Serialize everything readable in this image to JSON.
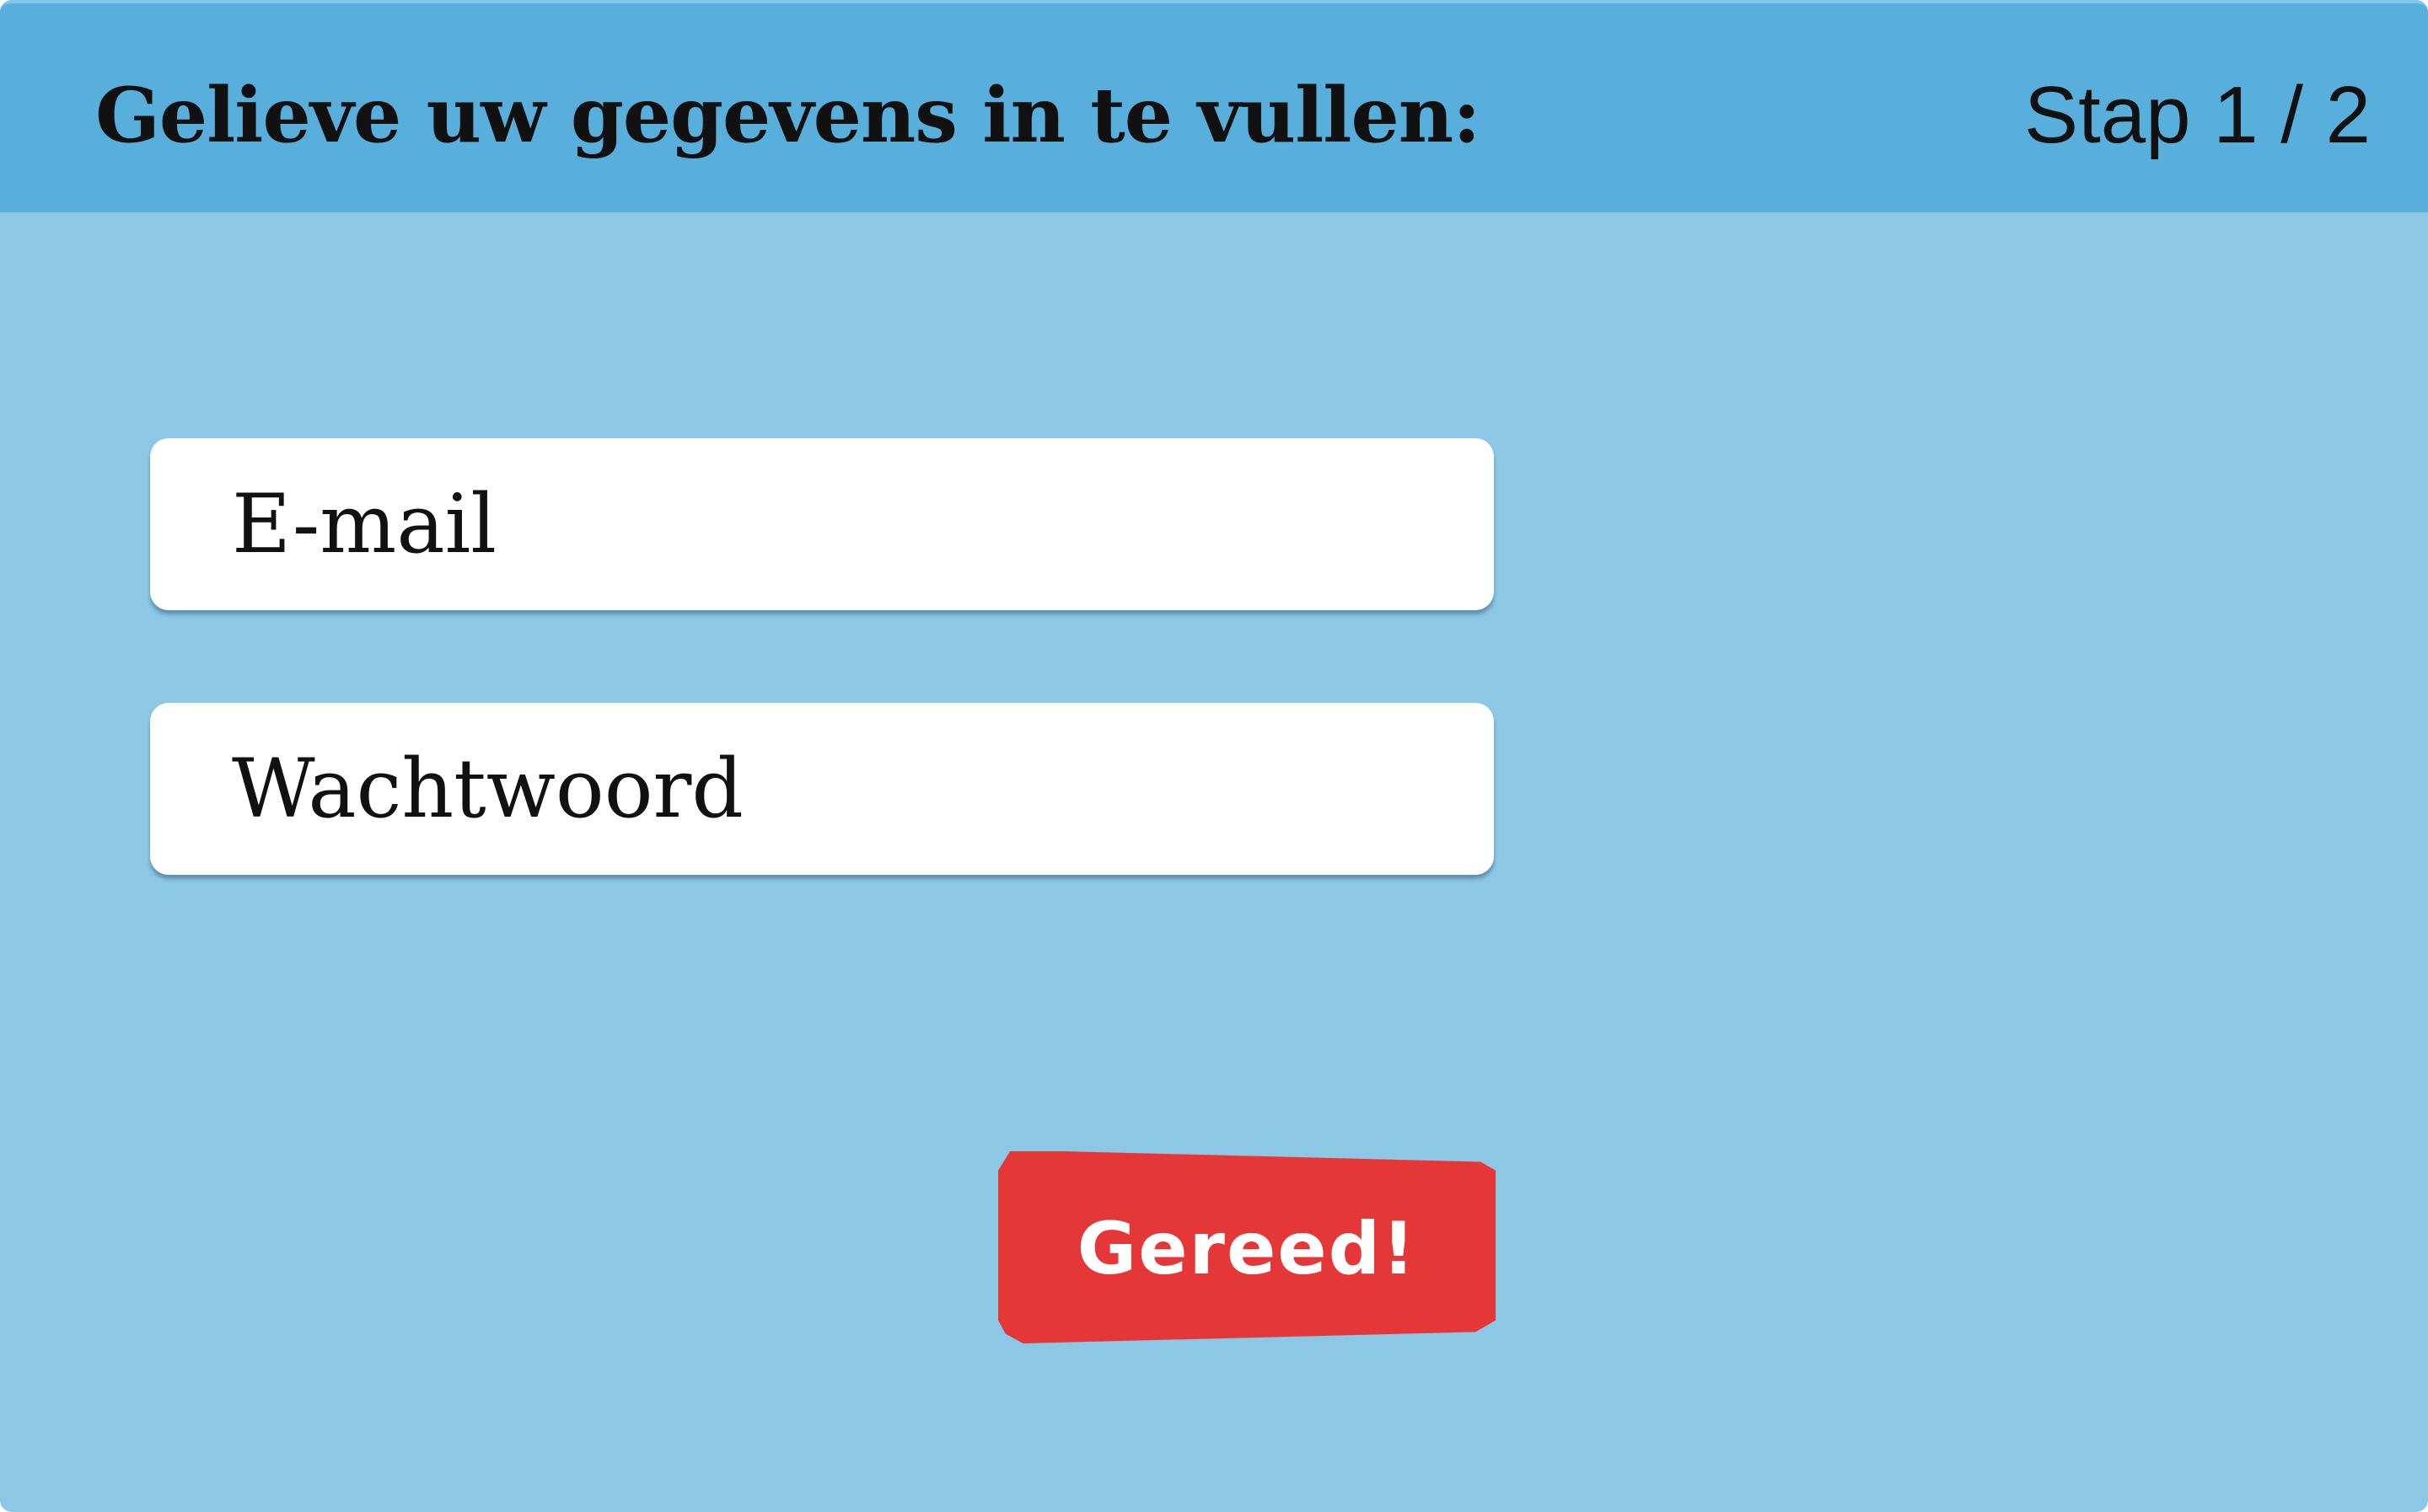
{
  "header": {
    "title": "Gelieve uw gegevens in te vullen:",
    "step": "Stap 1 / 2"
  },
  "form": {
    "email_placeholder": "E-mail",
    "password_placeholder": "Wachtwoord",
    "submit_label": "Gereed!"
  },
  "colors": {
    "background": "#8cc7e5",
    "header": "#58afdb",
    "button": "#e53638",
    "field": "#ffffff",
    "text": "#111111"
  }
}
